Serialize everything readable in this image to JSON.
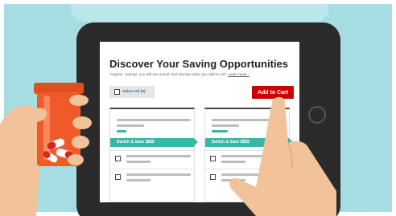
{
  "screen": {
    "title": "Discover Your Saving Opportunities",
    "note": "*Approx. savings, you will see actual cost savings when you add to cart.",
    "learn_more": "Learn more ›",
    "select_all": "Select All (0)",
    "add_to_cart": "Add to Cart",
    "cards": [
      {
        "switch_label": "Switch & Save $$$$"
      },
      {
        "switch_label": "Switch & Save $$$$"
      }
    ]
  },
  "colors": {
    "background": "#a6dde3",
    "tablet": "#2b2b2b",
    "accent_teal": "#37b8a6",
    "add_to_cart": "#cc0000",
    "bottle": "#f05a28",
    "skin": "#f2c29b"
  },
  "icons": [
    "checkbox-icon",
    "pill-bottle-icon",
    "hand-icon"
  ]
}
